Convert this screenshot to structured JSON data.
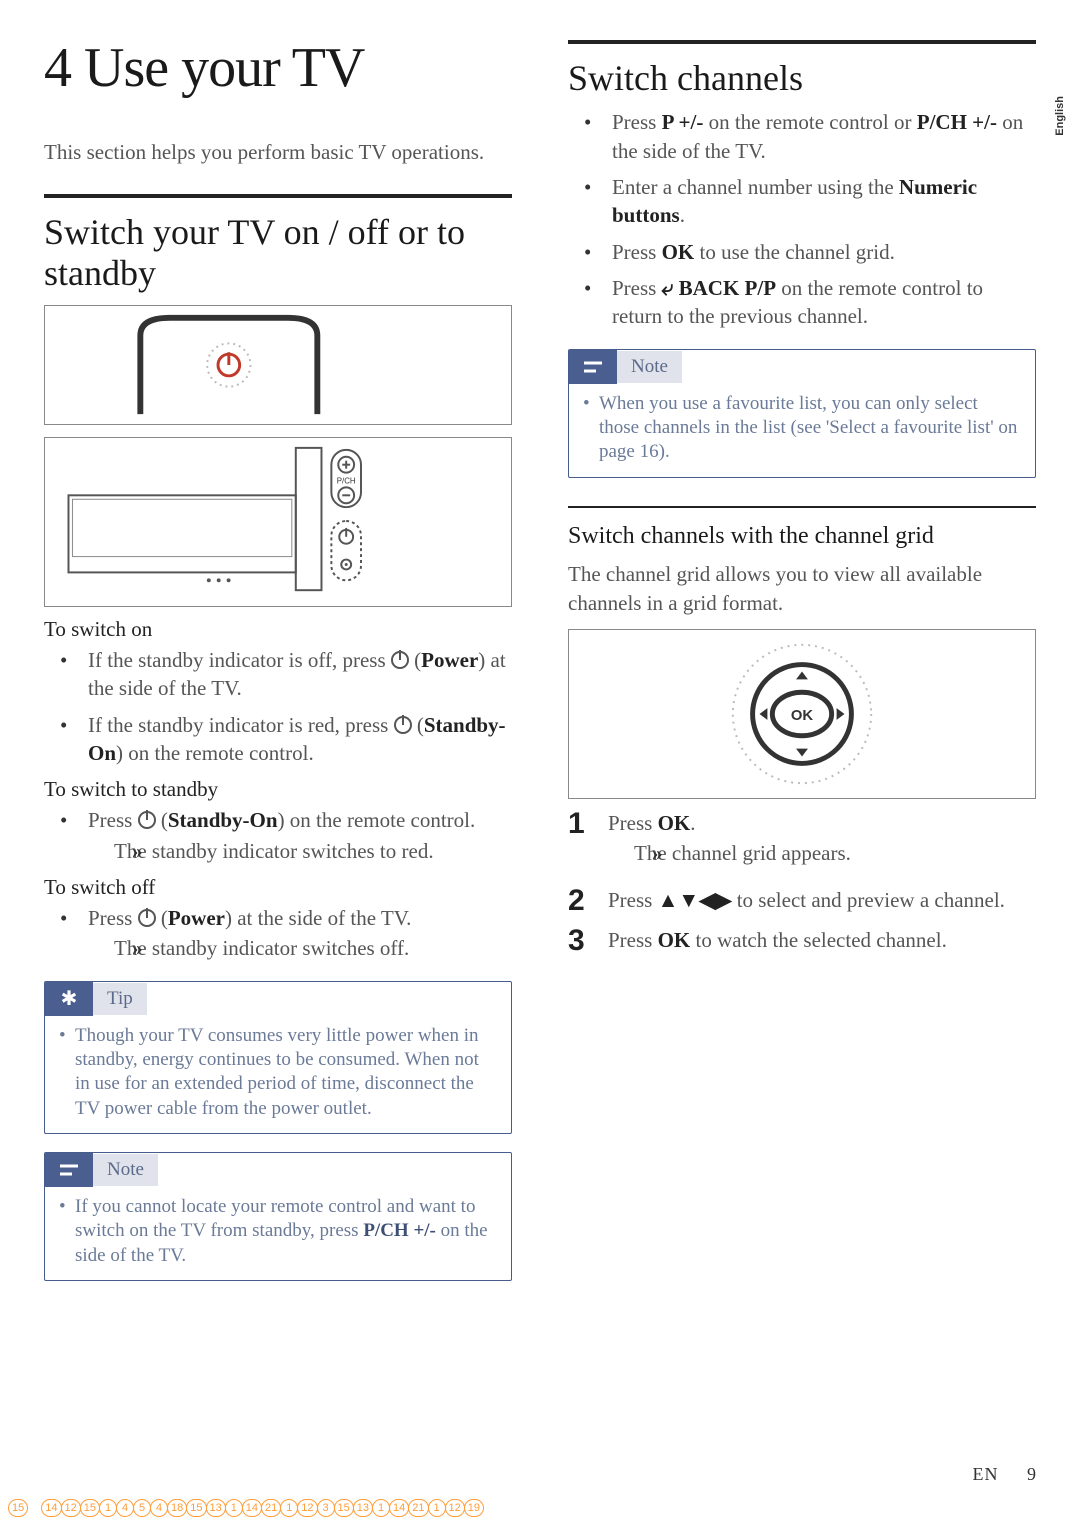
{
  "lang_tab": "English",
  "chapter_title": "4   Use your TV",
  "intro": "This section helps you perform basic TV operations.",
  "left": {
    "section_heading": "Switch your TV on / off or to standby",
    "switch_on_head": "To switch on",
    "switch_on_items": [
      {
        "pre": "If the standby indicator is off, press ",
        "strong": "Power",
        "post": ") at the side of the TV."
      },
      {
        "pre": "If the standby indicator is red, press ",
        "strong": "Standby-On",
        "post": ") on the remote control."
      }
    ],
    "switch_standby_head": "To switch to standby",
    "switch_standby_item_pre": "Press ",
    "switch_standby_item_strong": "Standby-On",
    "switch_standby_item_post": ") on the remote control.",
    "switch_standby_arrow": "The standby indicator switches to red.",
    "switch_off_head": "To switch off",
    "switch_off_item_pre": "Press ",
    "switch_off_item_strong": "Power",
    "switch_off_item_post": ") at the side of the TV.",
    "switch_off_arrow": "The standby indicator switches off.",
    "tip_label": "Tip",
    "tip_body": "Though your TV consumes very little power when in standby, energy continues to be consumed. When not in use for an extended period of time, disconnect the TV power cable from the power outlet.",
    "note_label": "Note",
    "note_body_pre": "If you cannot locate your remote control and want to switch on the TV from standby, press ",
    "note_body_strong": "P/CH +/-",
    "note_body_post": " on the side of the TV."
  },
  "right": {
    "section_heading": "Switch channels",
    "bullets": [
      {
        "pre": "Press ",
        "s1": "P +/-",
        "mid": " on the remote control or ",
        "s2": "P/CH +/-",
        "post": " on the side of the TV."
      },
      {
        "pre": "Enter a channel number using the ",
        "s1": "Numeric buttons",
        "mid": "",
        "s2": "",
        "post": "."
      },
      {
        "pre": "Press ",
        "s1": "OK",
        "mid": " to use the channel grid.",
        "s2": "",
        "post": ""
      },
      {
        "pre": "Press ",
        "s1": "⤶ BACK P/P",
        "mid": " on the remote control to return to the previous channel.",
        "s2": "",
        "post": ""
      }
    ],
    "note_label": "Note",
    "note_body": "When you use a favourite list, you can only select those channels in the list (see 'Select a favourite list' on page 16).",
    "sub_heading": "Switch channels with the channel grid",
    "sub_intro": "The channel grid allows you to view all available channels in a grid format.",
    "steps": [
      {
        "n": "1",
        "pre": "Press ",
        "strong": "OK",
        "post": ".",
        "arrow": "The channel grid appears."
      },
      {
        "n": "2",
        "pre": "Press ",
        "strong": "▲▼◀▶",
        "post": " to select and preview a channel.",
        "arrow": ""
      },
      {
        "n": "3",
        "pre": "Press ",
        "strong": "OK",
        "post": " to watch the selected channel.",
        "arrow": ""
      }
    ]
  },
  "footer": {
    "lang": "EN",
    "page": "9"
  },
  "chain": [
    "15",
    "14",
    "12",
    "15",
    "1",
    "4",
    "5",
    "4",
    "18",
    "15",
    "13",
    "1",
    "14",
    "21",
    "1",
    "12",
    "3",
    "15",
    "13",
    "1",
    "14",
    "21",
    "1",
    "12",
    "19"
  ]
}
